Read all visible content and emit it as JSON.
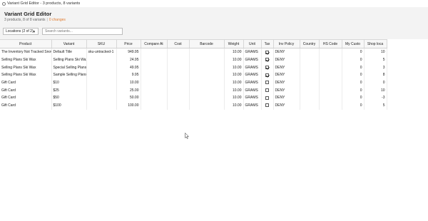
{
  "window": {
    "title": "Variant Grid Editor - 3 products, 8 variants"
  },
  "header": {
    "title": "Variant Grid Editor",
    "summary": "3 products, 8 of 8 variants",
    "separator": "|",
    "changes": "0 changes",
    "accent_color": "#e07a2e"
  },
  "toolbar": {
    "locations_label": "Locations (2 of 2)",
    "locations_caret": "▼",
    "search_placeholder": "Search variants...",
    "search_value": ""
  },
  "grid": {
    "columns": [
      "Product",
      "Variant",
      "SKU",
      "Price",
      "Compare At",
      "Cost",
      "Barcode",
      "Weight",
      "Unit",
      "Tax",
      "Inv Policy",
      "Country",
      "HS Code",
      "My Custo",
      "Shop loca"
    ],
    "rows": [
      {
        "product": "The Inventory Not Tracked Snow",
        "variant": "Default Title",
        "sku": "sku-untracked-1",
        "price": "949.95",
        "compare_at": "",
        "cost": "",
        "barcode": "",
        "weight": "10.00",
        "unit": "GRAMS",
        "tax": true,
        "inv_policy": "DENY",
        "country": "",
        "hs_code": "",
        "my_custom": "0",
        "shop_loc": "10"
      },
      {
        "product": "Selling Plans Ski Wax",
        "variant": "Selling Plans Ski Wax",
        "sku": "",
        "price": "24.95",
        "compare_at": "",
        "cost": "",
        "barcode": "",
        "weight": "10.00",
        "unit": "GRAMS",
        "tax": true,
        "inv_policy": "DENY",
        "country": "",
        "hs_code": "",
        "my_custom": "0",
        "shop_loc": "5"
      },
      {
        "product": "Selling Plans Ski Wax",
        "variant": "Special Selling Plans",
        "sku": "",
        "price": "49.95",
        "compare_at": "",
        "cost": "",
        "barcode": "",
        "weight": "10.00",
        "unit": "GRAMS",
        "tax": true,
        "inv_policy": "DENY",
        "country": "",
        "hs_code": "",
        "my_custom": "0",
        "shop_loc": "3"
      },
      {
        "product": "Selling Plans Ski Wax",
        "variant": "Sample Selling Plans",
        "sku": "",
        "price": "9.95",
        "compare_at": "",
        "cost": "",
        "barcode": "",
        "weight": "10.00",
        "unit": "GRAMS",
        "tax": true,
        "inv_policy": "DENY",
        "country": "",
        "hs_code": "",
        "my_custom": "0",
        "shop_loc": "8"
      },
      {
        "product": "Gift Card",
        "variant": "$10",
        "sku": "",
        "price": "10.00",
        "compare_at": "",
        "cost": "",
        "barcode": "",
        "weight": "10.00",
        "unit": "GRAMS",
        "tax": false,
        "inv_policy": "DENY",
        "country": "",
        "hs_code": "",
        "my_custom": "0",
        "shop_loc": "0"
      },
      {
        "product": "Gift Card",
        "variant": "$25",
        "sku": "",
        "price": "25.00",
        "compare_at": "",
        "cost": "",
        "barcode": "",
        "weight": "10.00",
        "unit": "GRAMS",
        "tax": false,
        "inv_policy": "DENY",
        "country": "",
        "hs_code": "",
        "my_custom": "0",
        "shop_loc": "10"
      },
      {
        "product": "Gift Card",
        "variant": "$50",
        "sku": "",
        "price": "50.00",
        "compare_at": "",
        "cost": "",
        "barcode": "",
        "weight": "10.00",
        "unit": "GRAMS",
        "tax": false,
        "inv_policy": "DENY",
        "country": "",
        "hs_code": "",
        "my_custom": "0",
        "shop_loc": "-3"
      },
      {
        "product": "Gift Card",
        "variant": "$100",
        "sku": "",
        "price": "100.00",
        "compare_at": "",
        "cost": "",
        "barcode": "",
        "weight": "10.00",
        "unit": "GRAMS",
        "tax": false,
        "inv_policy": "DENY",
        "country": "",
        "hs_code": "",
        "my_custom": "0",
        "shop_loc": "5"
      }
    ]
  },
  "icons": {
    "app": "app-icon",
    "cursor": "mouse-pointer-icon"
  }
}
